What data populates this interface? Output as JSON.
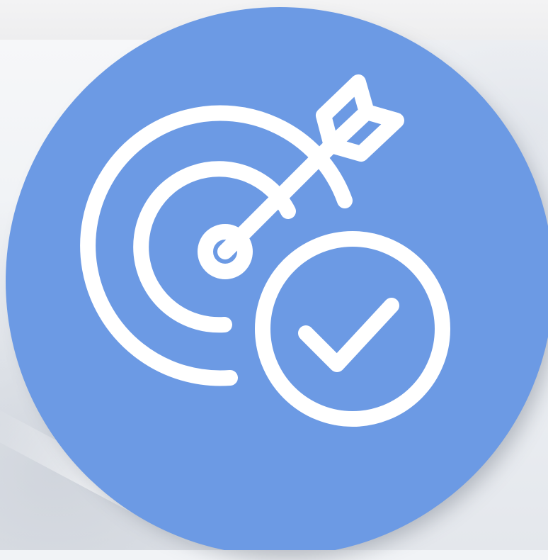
{
  "badge": {
    "fill_color": "#6c9ae4",
    "icon_color": "#ffffff",
    "icon": "target-arrow-check-icon"
  }
}
